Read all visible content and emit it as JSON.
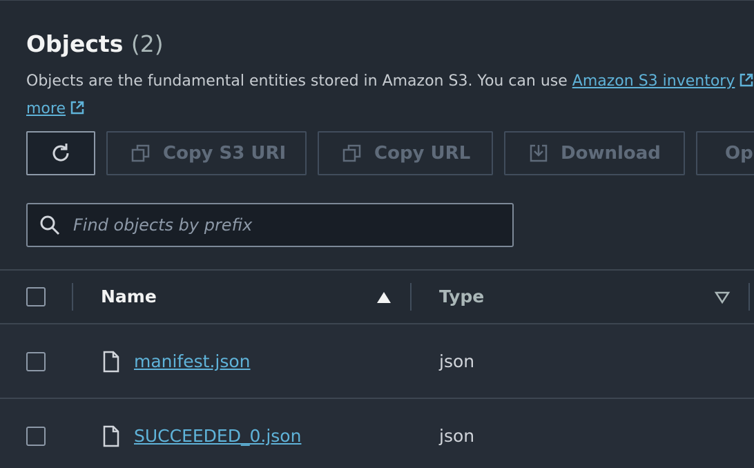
{
  "header": {
    "title": "Objects",
    "count": "(2)",
    "description_prefix": "Objects are the fundamental entities stored in Amazon S3. You can use ",
    "inventory_link": "Amazon S3 inventory",
    "more_link": "more"
  },
  "toolbar": {
    "refresh_icon": "refresh-icon",
    "copy_s3_uri": "Copy S3 URI",
    "copy_url": "Copy URL",
    "download": "Download",
    "open": "Op"
  },
  "search": {
    "placeholder": "Find objects by prefix"
  },
  "table": {
    "columns": [
      {
        "label": "Name",
        "sort": "ascending"
      },
      {
        "label": "Type",
        "sort": "sortable"
      }
    ],
    "rows": [
      {
        "name": "manifest.json",
        "type": "json",
        "icon": "file-icon"
      },
      {
        "name": "SUCCEEDED_0.json",
        "type": "json",
        "icon": "file-icon"
      }
    ]
  },
  "colors": {
    "background": "#232a33",
    "link": "#5fb3d9",
    "border": "#414d5c",
    "disabled_text": "#5f6b7a"
  }
}
